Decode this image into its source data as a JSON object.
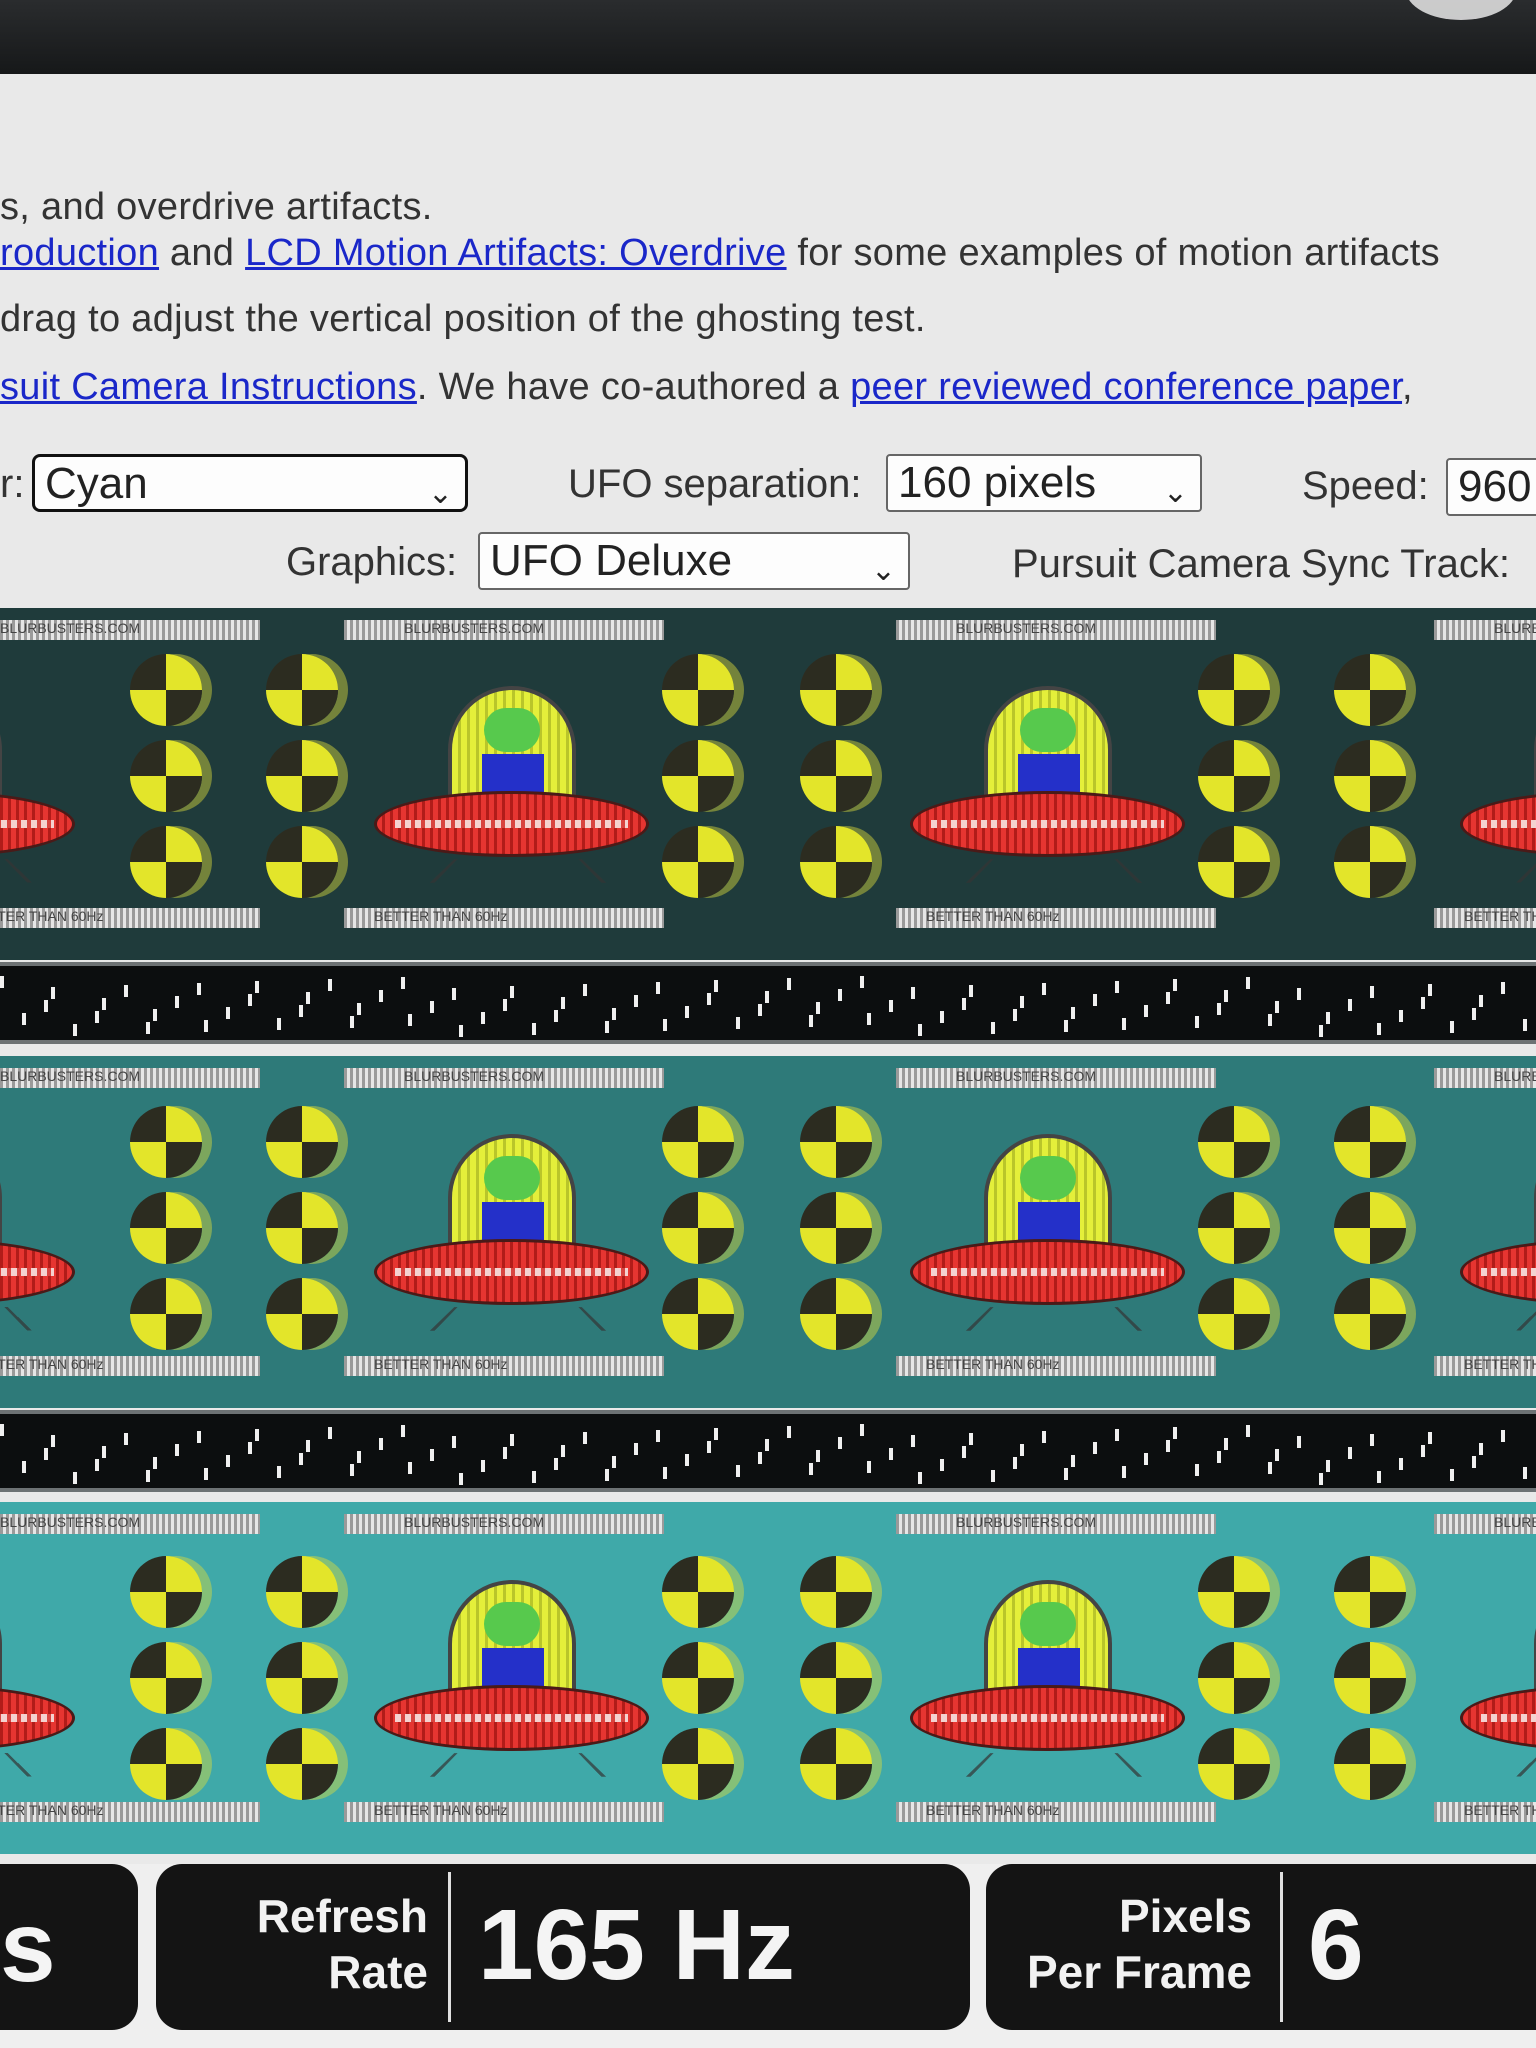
{
  "intro_lines": {
    "line1": "s, and overdrive artifacts.",
    "line2_link1": "roduction",
    "line2_mid": " and ",
    "line2_link2": "LCD Motion Artifacts: Overdrive",
    "line2_tail": " for some examples of motion artifacts",
    "line3": "drag to adjust the vertical position of the ghosting test.",
    "line4_link1": "suit Camera Instructions",
    "line4_mid": ". We have co-authored a ",
    "line4_link2": "peer reviewed conference paper",
    "line4_tail": ","
  },
  "controls": {
    "color_label_fragment": "r:",
    "color_value": "Cyan",
    "separation_label": "UFO separation:",
    "separation_value": "160 pixels",
    "speed_label": "Speed:",
    "speed_value": "960",
    "graphics_label": "Graphics:",
    "graphics_value": "UFO Deluxe",
    "sync_label": "Pursuit Camera Sync Track:"
  },
  "tracks": {
    "colors": [
      "#1f3b3b",
      "#2e7a79",
      "#3fa9a9"
    ],
    "top_caption": "BLURBUSTERS.COM",
    "bottom_caption": "BETTER THAN 60Hz"
  },
  "status_panels": {
    "left_fragment": "s",
    "refresh_label_line1": "Refresh",
    "refresh_label_line2": "Rate",
    "refresh_value": "165 Hz",
    "ppf_label_line1": "Pixels",
    "ppf_label_line2": "Per Frame",
    "ppf_value": "6"
  },
  "icons": {
    "dropdown": "chevron-down-icon"
  }
}
